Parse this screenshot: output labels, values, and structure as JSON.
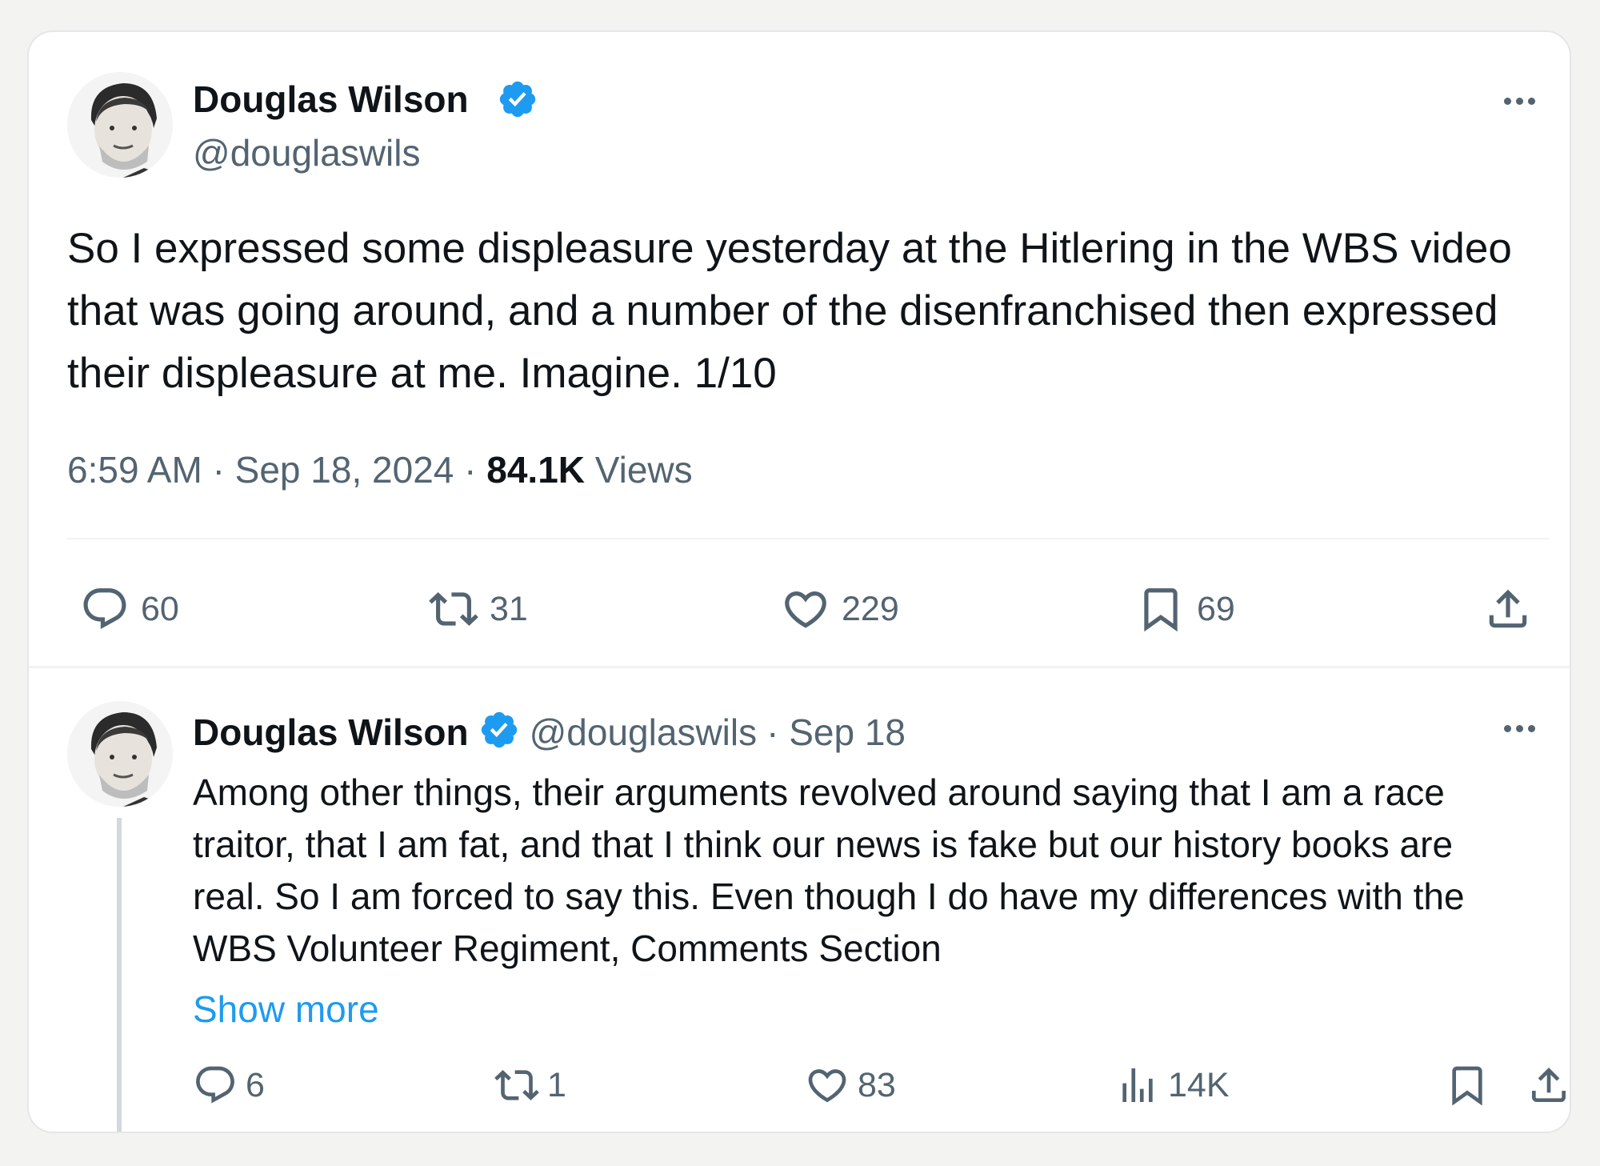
{
  "main_tweet": {
    "author_name": "Douglas Wilson",
    "handle": "@douglaswils",
    "text": "So I expressed some displeasure yesterday at the Hitlering in the WBS video that was going around, and a number of the disenfranchised then expressed their displeasure at me. Imagine. 1/10",
    "time": "6:59 AM",
    "date": "Sep 18, 2024",
    "views_count": "84.1K",
    "views_label": "Views",
    "separator": "·",
    "replies": "60",
    "retweets": "31",
    "likes": "229",
    "bookmarks": "69"
  },
  "reply_tweet": {
    "author_name": "Douglas Wilson",
    "handle": "@douglaswils",
    "date": "· Sep 18",
    "text": "Among other things, their arguments revolved around saying that I am a race traitor, that I am fat, and that I think our news is fake but our history books are real. So I am forced to say this. Even though I do have my differences with the WBS Volunteer Regiment, Comments Section",
    "show_more": "Show more",
    "replies": "6",
    "retweets": "1",
    "likes": "83",
    "views": "14K"
  },
  "colors": {
    "verified": "#1d9bf0",
    "link": "#1d9bf0",
    "secondary_text": "#536471"
  },
  "icons": [
    "verified-badge-icon",
    "more-icon",
    "reply-icon",
    "retweet-icon",
    "like-icon",
    "bookmark-icon",
    "share-icon",
    "views-icon"
  ]
}
